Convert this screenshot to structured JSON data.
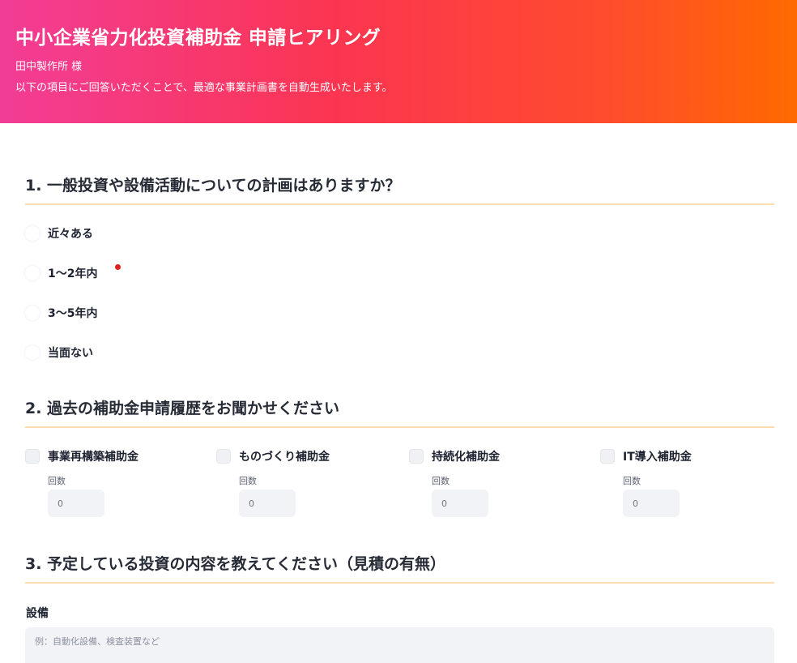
{
  "header": {
    "title": "中小企業省力化投資補助金 申請ヒアリング",
    "client": "田中製作所 様",
    "description": "以下の項目にご回答いただくことで、最適な事業計画書を自動生成いたします。"
  },
  "q1": {
    "title": "1. 一般投資や設備活動についての計画はありますか？",
    "options": [
      "近々ある",
      "1〜2年内",
      "3〜5年内",
      "当面ない"
    ]
  },
  "q2": {
    "title": "2. 過去の補助金申請履歴をお聞かせください",
    "items": [
      {
        "label": "事業再構築補助金",
        "count_label": "回数",
        "count_value": "0"
      },
      {
        "label": "ものづくり補助金",
        "count_label": "回数",
        "count_value": "0"
      },
      {
        "label": "持続化補助金",
        "count_label": "回数",
        "count_value": "0"
      },
      {
        "label": "IT導入補助金",
        "count_label": "回数",
        "count_value": "0"
      }
    ]
  },
  "q3": {
    "title": "3. 予定している投資の内容を教えてください（見積の有無）",
    "equipment_label": "設備",
    "equipment_placeholder": "例：自動化設備、検査装置など"
  },
  "colors": {
    "gradient_start": "#f23d97",
    "gradient_end": "#ff6a00",
    "section_underline": "#fbdcae",
    "indicator_dot": "#e0201c"
  }
}
